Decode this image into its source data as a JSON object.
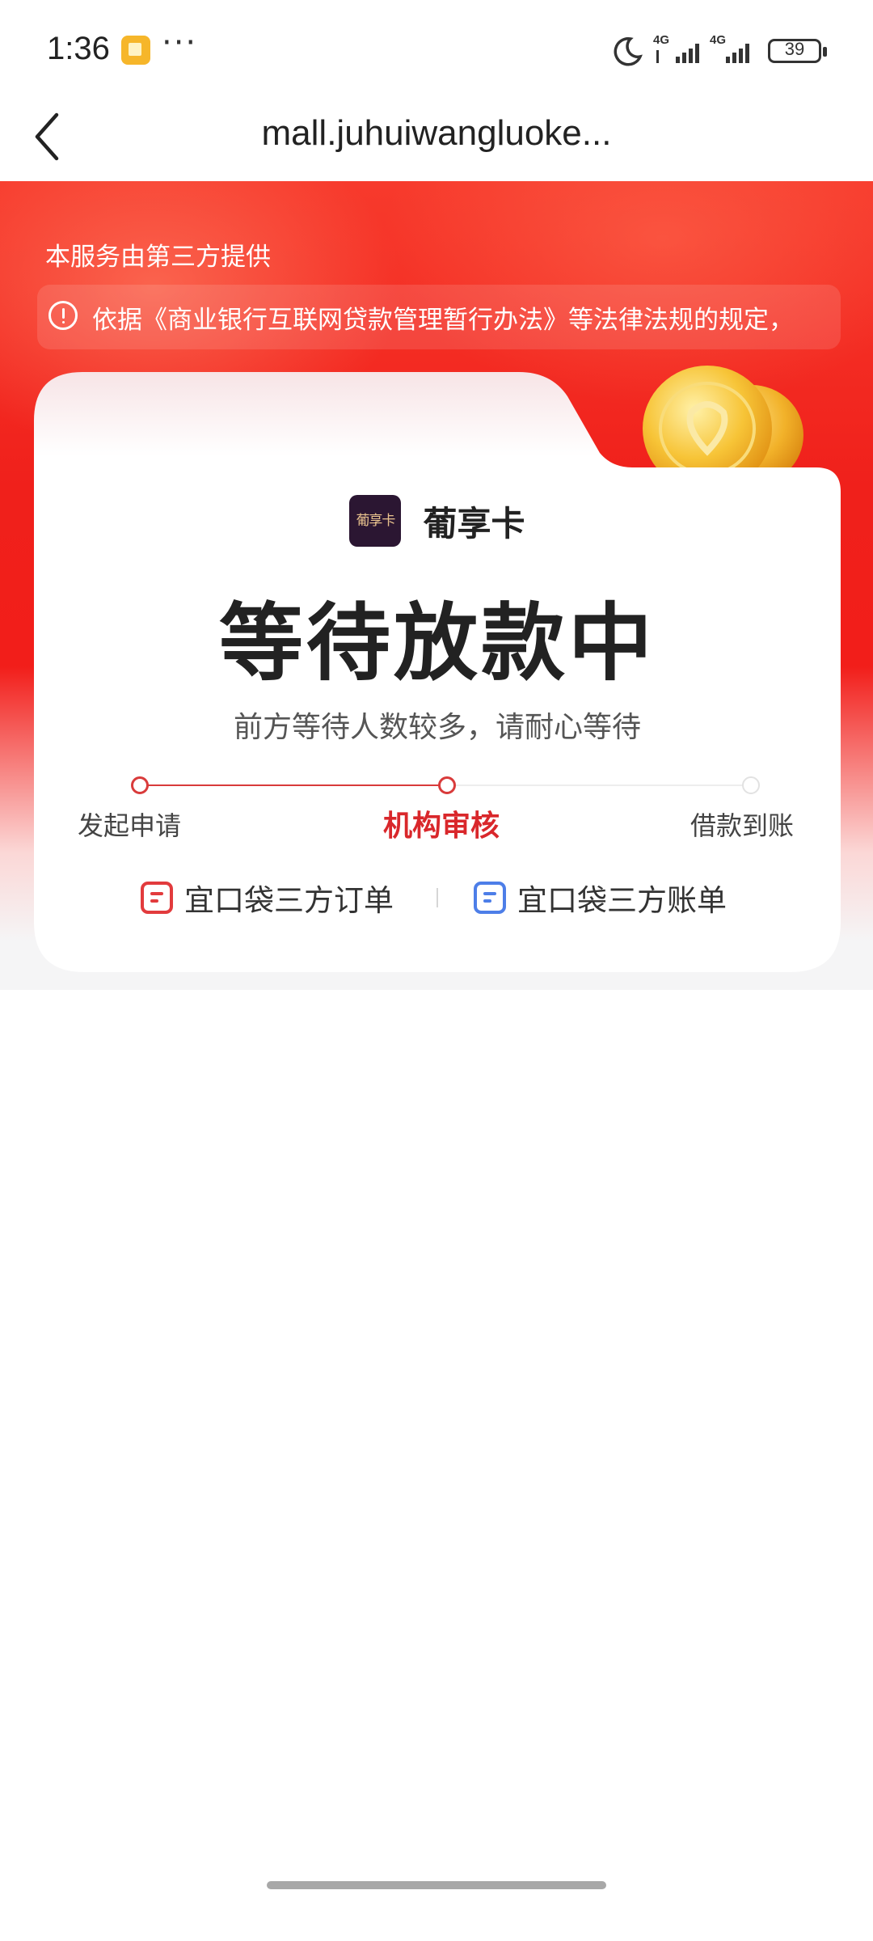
{
  "status_bar": {
    "time": "1:36",
    "more_indicator": "···",
    "network_1": "4G",
    "network_2": "4G",
    "battery": "39"
  },
  "nav": {
    "title": "mall.juhuiwangluoke..."
  },
  "hero": {
    "provider_note": "本服务由第三方提供",
    "notice": "依据《商业银行互联网贷款管理暂行办法》等法律法规的规定，"
  },
  "card": {
    "brand_logo_text": "葡享卡",
    "brand_name": "葡享卡",
    "headline": "等待放款中",
    "subtitle": "前方等待人数较多，请耐心等待",
    "steps": [
      {
        "label": "发起申请",
        "state": "done"
      },
      {
        "label": "机构审核",
        "state": "active"
      },
      {
        "label": "借款到账",
        "state": "todo"
      }
    ],
    "links": {
      "order": "宜口袋三方订单",
      "bill": "宜口袋三方账单"
    }
  },
  "colors": {
    "hero_red": "#f0201b",
    "accent_red": "#d9272b",
    "link_blue": "#4d7ee8"
  },
  "icons": {
    "back": "chevron-left-icon",
    "notice": "info-circle-icon",
    "order": "order-doc-icon",
    "bill": "bill-doc-icon"
  }
}
